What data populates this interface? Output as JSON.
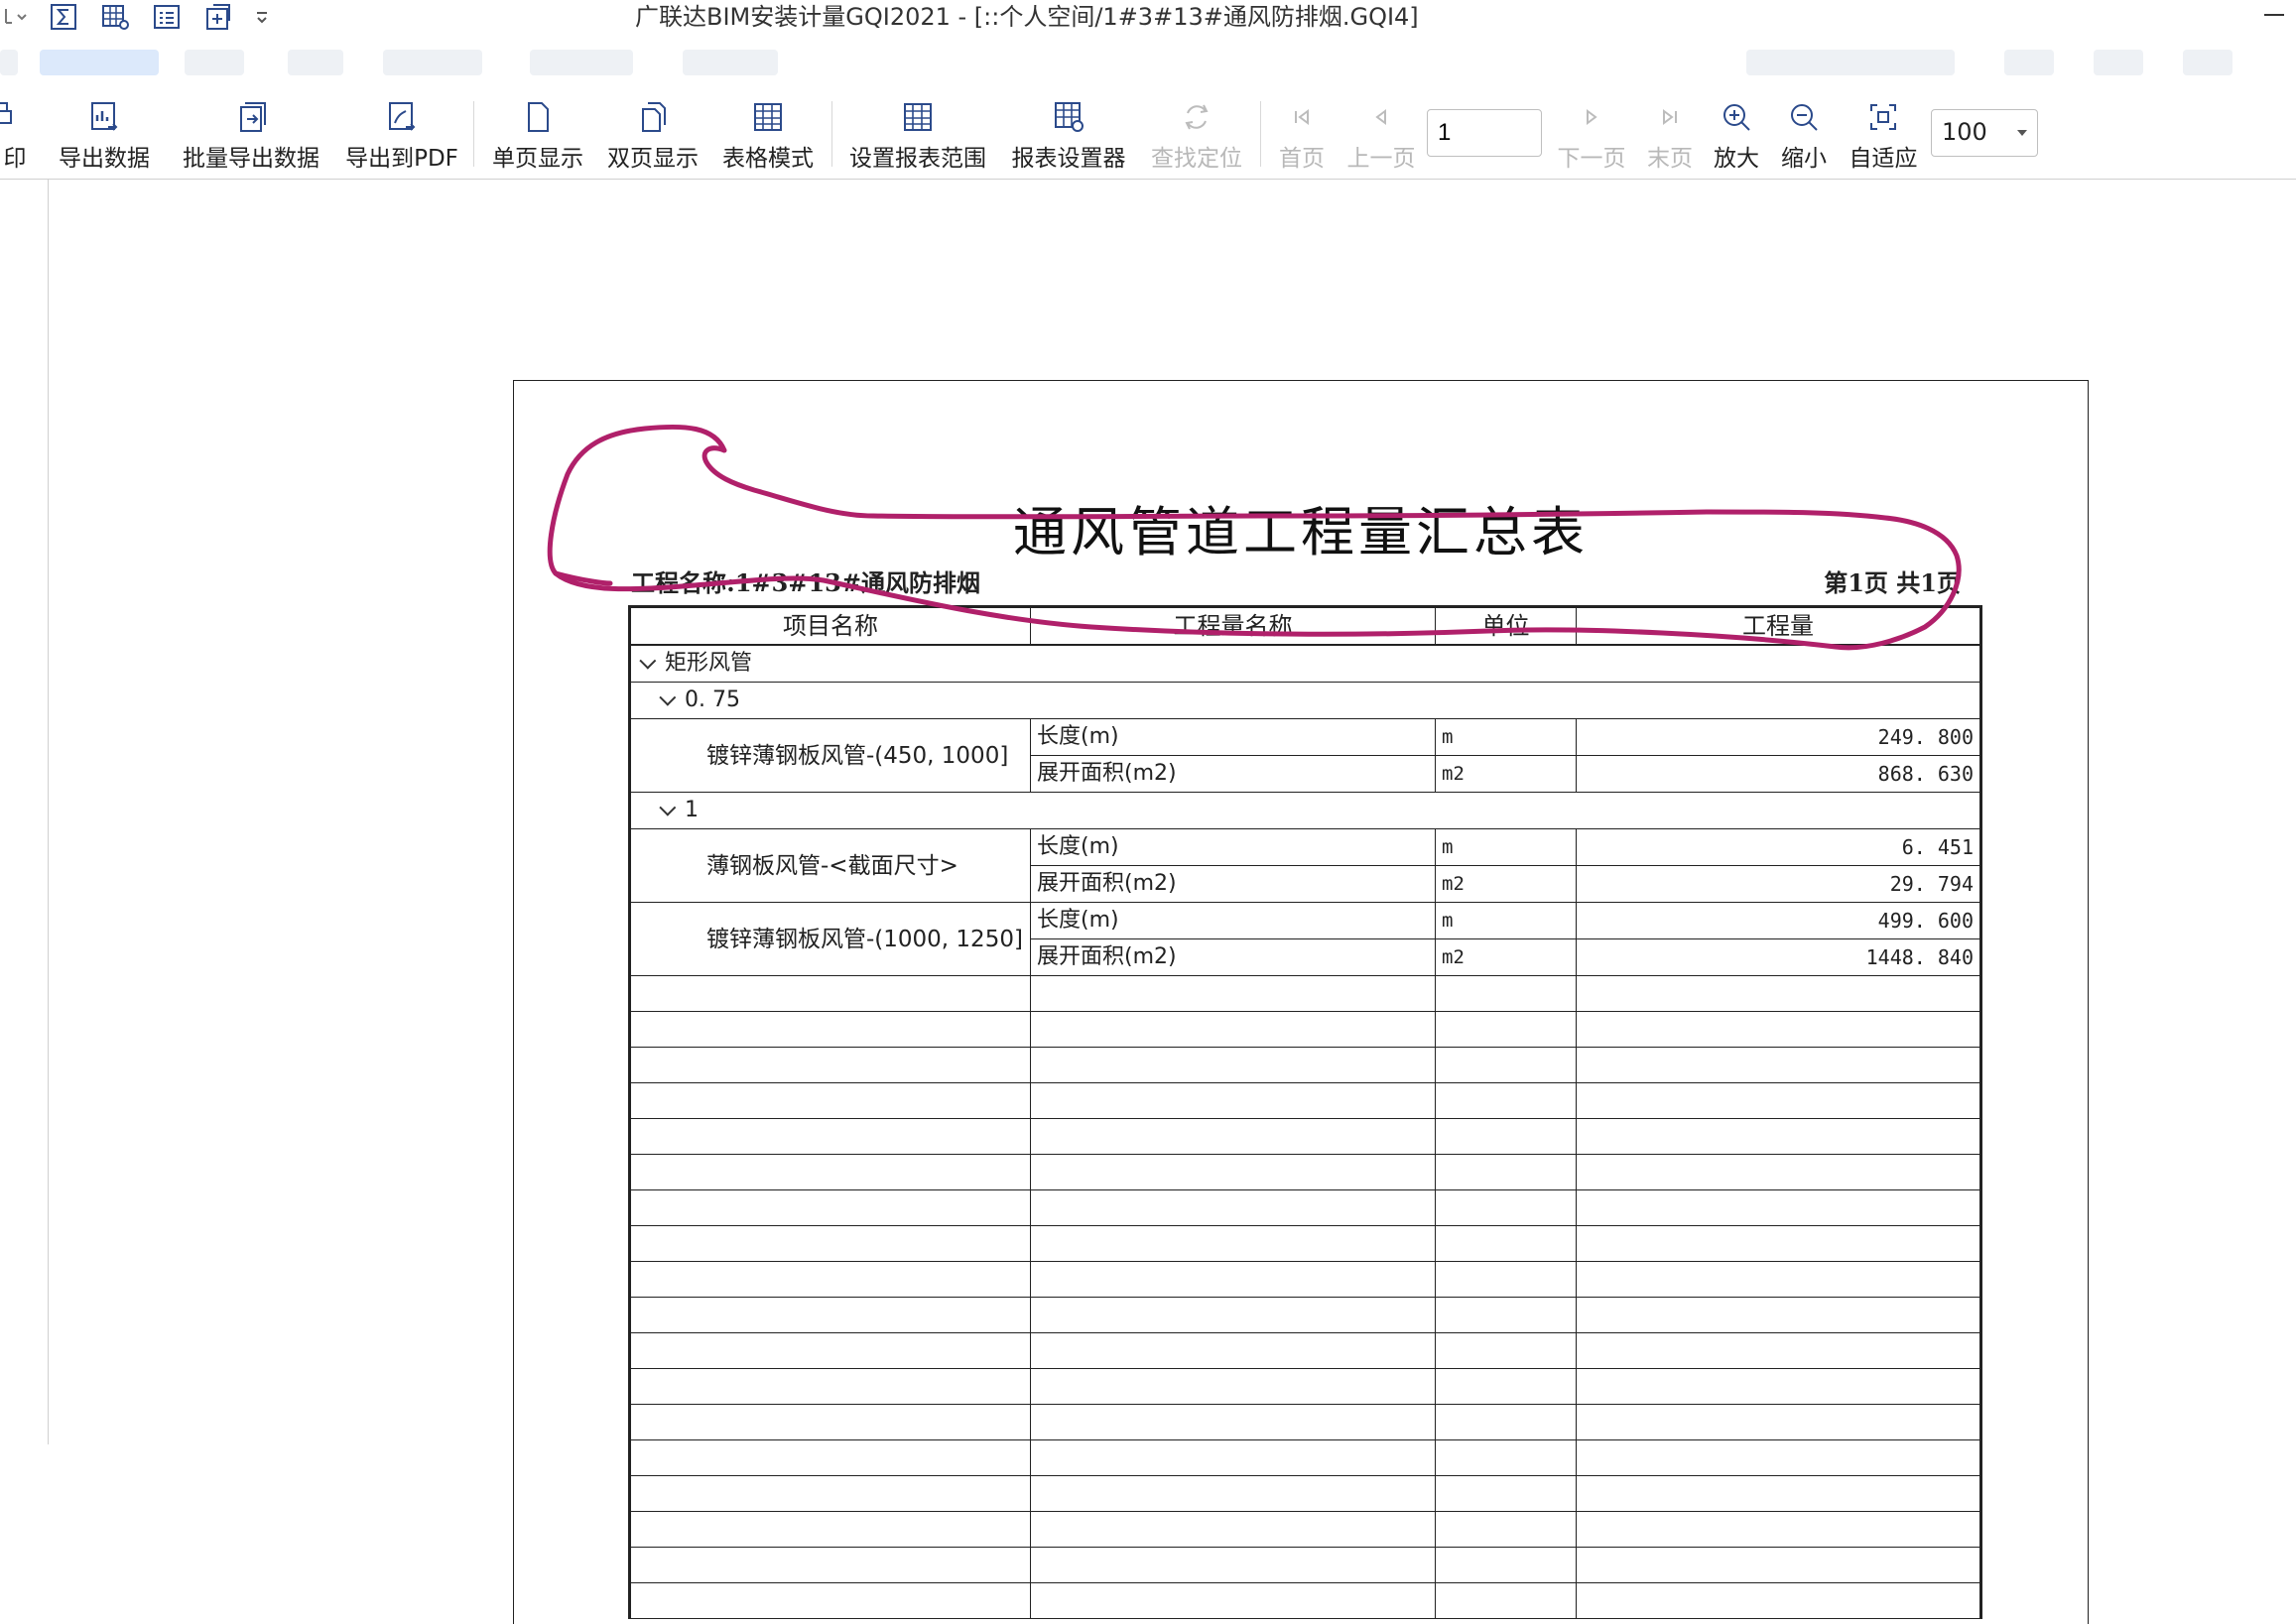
{
  "window": {
    "title": "广联达BIM安装计量GQI2021 - [::个人空间/1#3#13#通风防排烟.GQI4]"
  },
  "toolbar": {
    "print_partial": "印",
    "export_data": "导出数据",
    "batch_export": "批量导出数据",
    "export_pdf": "导出到PDF",
    "single_page": "单页显示",
    "double_page": "双页显示",
    "table_mode": "表格模式",
    "report_range": "设置报表范围",
    "report_designer": "报表设置器",
    "find_locate": "查找定位",
    "first_page": "首页",
    "prev_page": "上一页",
    "page_value": "1",
    "next_page": "下一页",
    "last_page": "末页",
    "zoom_in": "放大",
    "zoom_out": "缩小",
    "fit": "自适应",
    "zoom_value": "100"
  },
  "report": {
    "title": "通风管道工程量汇总表",
    "project_label": "工程名称:1#3#13#通风防排烟",
    "page_info": "第1页  共1页",
    "headers": [
      "项目名称",
      "工程量名称",
      "单位",
      "工程量"
    ],
    "group1": "矩形风管",
    "sub1": "0. 75",
    "item1_name": "镀锌薄钢板风管-(450, 1000]",
    "item1_rows": [
      {
        "qty_name": "长度(m)",
        "unit": "m",
        "value": "249. 800"
      },
      {
        "qty_name": "展开面积(m2)",
        "unit": "m2",
        "value": "868. 630"
      }
    ],
    "sub2": "1",
    "item2_name": "薄钢板风管-<截面尺寸>",
    "item2_rows": [
      {
        "qty_name": "长度(m)",
        "unit": "m",
        "value": "6. 451"
      },
      {
        "qty_name": "展开面积(m2)",
        "unit": "m2",
        "value": "29. 794"
      }
    ],
    "item3_name": "镀锌薄钢板风管-(1000, 1250]",
    "item3_rows": [
      {
        "qty_name": "长度(m)",
        "unit": "m",
        "value": "499. 600"
      },
      {
        "qty_name": "展开面积(m2)",
        "unit": "m2",
        "value": "1448. 840"
      }
    ]
  },
  "colors": {
    "annotation": "#b0206a",
    "accent": "#7dc36b"
  }
}
